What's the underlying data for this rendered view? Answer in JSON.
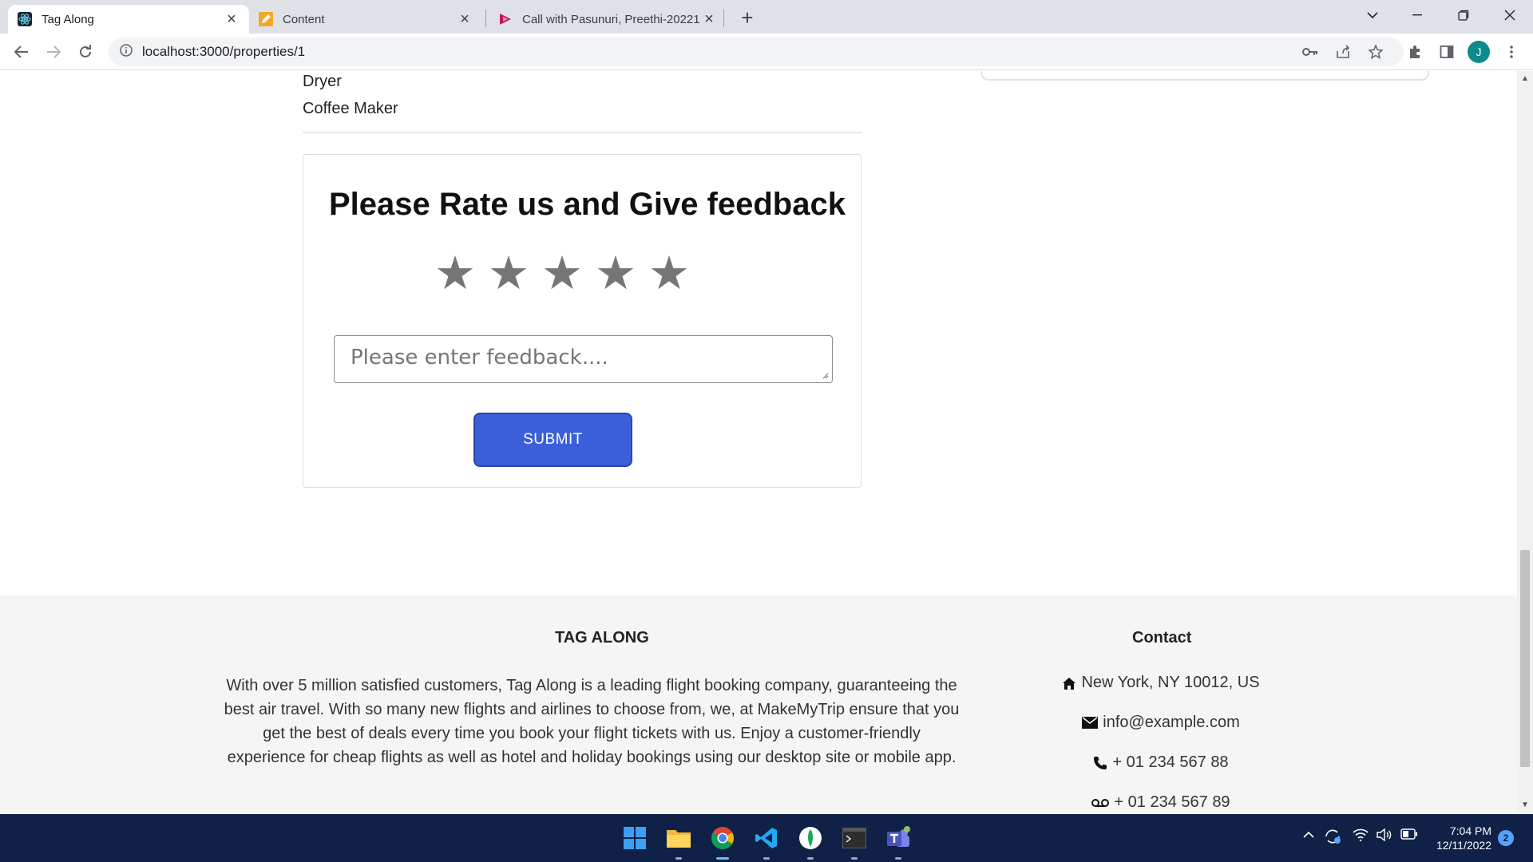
{
  "browser": {
    "tabs": [
      {
        "title": "Tag Along",
        "active": true
      },
      {
        "title": "Content",
        "active": false
      },
      {
        "title": "Call with Pasunuri, Preethi-20221",
        "active": false
      }
    ],
    "url": "localhost:3000/properties/1",
    "profile_initial": "J"
  },
  "amenities": [
    "Dryer",
    "Coffee Maker"
  ],
  "feedback": {
    "title": "Please Rate us and Give feedback",
    "stars": [
      "★",
      "★",
      "★",
      "★",
      "★"
    ],
    "placeholder": "Please enter feedback....",
    "submit_label": "SUBMIT",
    "star_color": "#757575",
    "button_color": "#3b5fd8"
  },
  "footer": {
    "brand": "TAG ALONG",
    "about": "With over 5 million satisfied customers, Tag Along is a leading flight booking company, guaranteeing the best air travel. With so many new flights and airlines to choose from, we, at MakeMyTrip ensure that you get the best of deals every time you book your flight tickets with us. Enjoy a customer-friendly experience for cheap flights as well as hotel and holiday bookings using our desktop site or mobile app.",
    "contact_title": "Contact",
    "contacts": [
      {
        "icon": "home-icon",
        "text": "New York, NY 10012, US"
      },
      {
        "icon": "envelope-icon",
        "text": "info@example.com"
      },
      {
        "icon": "phone-icon",
        "text": "+ 01 234 567 88"
      },
      {
        "icon": "voicemail-icon",
        "text": "+ 01 234 567 89"
      }
    ]
  },
  "taskbar": {
    "time": "7:04 PM",
    "date": "12/11/2022",
    "notification_count": "2"
  }
}
